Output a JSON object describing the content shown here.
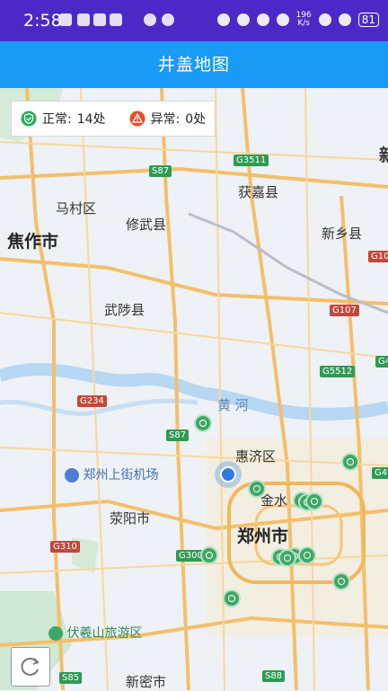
{
  "status_bar": {
    "time": "2:58",
    "network_speed_value": "196",
    "network_speed_unit": "K/s",
    "battery": "81"
  },
  "app_bar": {
    "title": "井盖地图"
  },
  "legend": {
    "normal_label": "正常:",
    "normal_count": "14处",
    "abnormal_label": "异常:",
    "abnormal_count": "0处",
    "normal_color": "#2eaa57",
    "abnormal_color": "#e5502b"
  },
  "map": {
    "places": {
      "jiaozuo": "焦作市",
      "macun": "马村区",
      "xiuwu": "修武县",
      "huojia": "获嘉县",
      "xinxiang": "新乡县",
      "wuzhi": "武陟县",
      "huiji": "惠济区",
      "jinshui": "金水",
      "zhengzhou": "郑州市",
      "xingyang": "荥阳市",
      "xinmi": "新密市",
      "airport": "郑州上街机场",
      "fuxi": "伏羲山旅游区",
      "xin_edge": "新",
      "yellow_river": "黄 河"
    },
    "road_labels": {
      "g3511": "G3511",
      "s87a": "S87",
      "s87b": "S87",
      "g107": "G107",
      "g5512": "G5512",
      "g234": "G234",
      "g310": "G310",
      "g3001": "G3001",
      "s85": "S85",
      "s88": "S88",
      "g10": "G10",
      "g4a": "G4",
      "g4b": "G4"
    },
    "manhole_marker_count": 13
  },
  "refresh_button": {
    "icon": "refresh-icon"
  }
}
